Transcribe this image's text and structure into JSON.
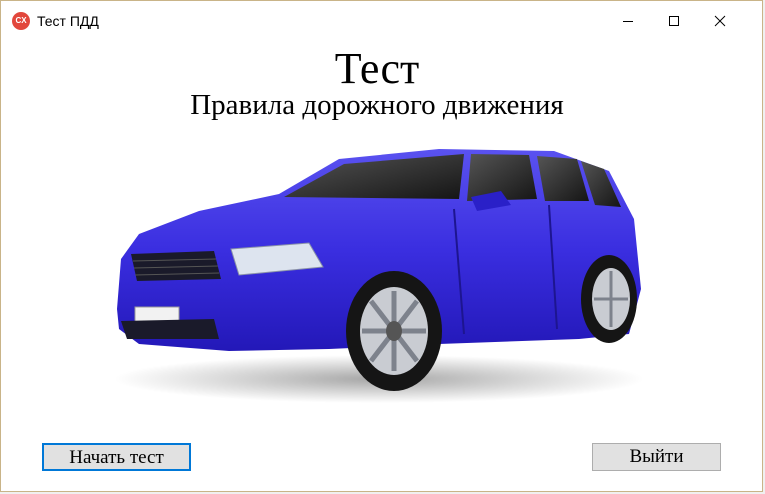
{
  "window": {
    "title": "Тест ПДД",
    "icon_text": "CX",
    "icon": "app-logo-icon",
    "controls": [
      "minimize-icon",
      "maximize-icon",
      "close-icon"
    ]
  },
  "main": {
    "title": "Тест",
    "subtitle": "Правила дорожного движения",
    "image": "blue-car-illustration"
  },
  "buttons": {
    "start_label": "Начать тест",
    "exit_label": "Выйти"
  },
  "colors": {
    "car_body": "#3a2ee0",
    "focus_border": "#0078d7",
    "button_bg": "#e1e1e1"
  }
}
